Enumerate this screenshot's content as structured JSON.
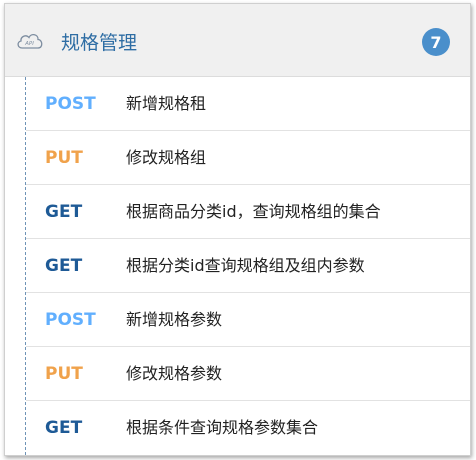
{
  "group": {
    "icon": "cloud-api-icon",
    "icon_text": "API",
    "title": "规格管理",
    "count": "7"
  },
  "colors": {
    "POST": "#61affe",
    "PUT": "#f0a24b",
    "GET": "#1e5a96",
    "title": "#2e6da4",
    "badge": "#4a8fcb"
  },
  "endpoints": [
    {
      "method": "POST",
      "label": "新增规格租"
    },
    {
      "method": "PUT",
      "label": "修改规格组"
    },
    {
      "method": "GET",
      "label": "根据商品分类id，查询规格组的集合"
    },
    {
      "method": "GET",
      "label": "根据分类id查询规格组及组内参数"
    },
    {
      "method": "POST",
      "label": "新增规格参数"
    },
    {
      "method": "PUT",
      "label": "修改规格参数"
    },
    {
      "method": "GET",
      "label": "根据条件查询规格参数集合"
    }
  ]
}
